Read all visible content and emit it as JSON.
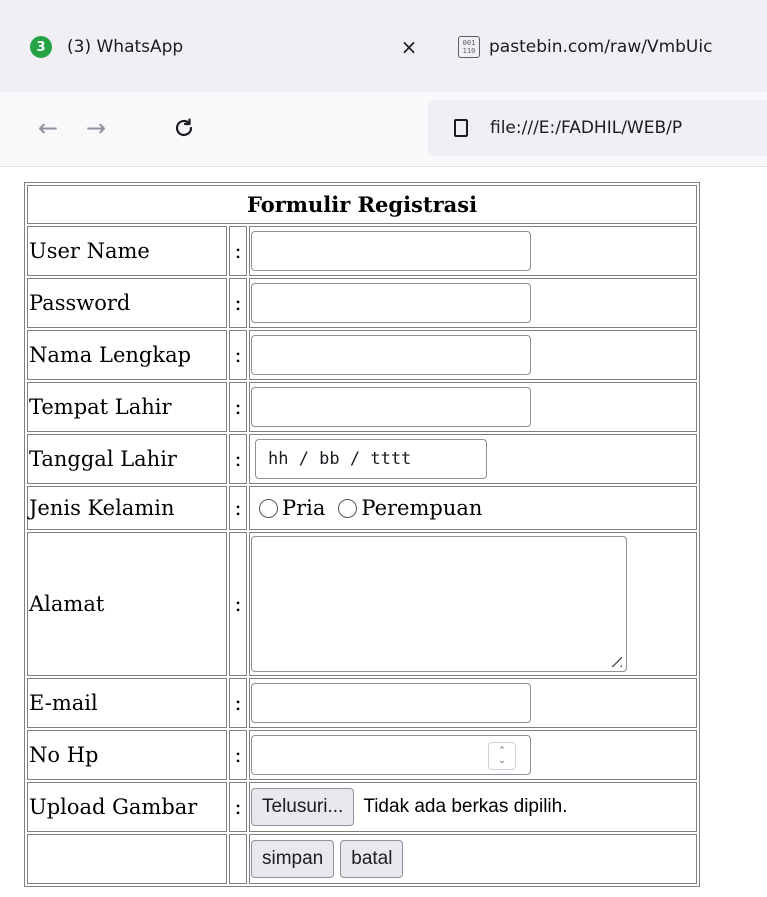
{
  "browser": {
    "tabs": [
      {
        "badge": "3",
        "title": "(3) WhatsApp",
        "close": "×"
      },
      {
        "icon_text": "001\n110",
        "title": "pastebin.com/raw/VmbUic"
      }
    ],
    "nav": {
      "back": "←",
      "forward": "→",
      "reload": "C"
    },
    "url": "file:///E:/FADHIL/WEB/P"
  },
  "form": {
    "title": "Formulir Registrasi",
    "colon": ":",
    "labels": {
      "username": "User Name",
      "password": "Password",
      "fullname": "Nama Lengkap",
      "birthplace": "Tempat Lahir",
      "birthdate": "Tanggal Lahir",
      "gender": "Jenis Kelamin",
      "address": "Alamat",
      "email": "E-mail",
      "phone": "No Hp",
      "upload": "Upload Gambar"
    },
    "date_placeholder": "hh / bb / tttt",
    "gender_options": [
      "Pria",
      "Perempuan"
    ],
    "file_button": "Telusuri...",
    "file_status": "Tidak ada berkas dipilih.",
    "submit_button": "simpan",
    "cancel_button": "batal"
  }
}
